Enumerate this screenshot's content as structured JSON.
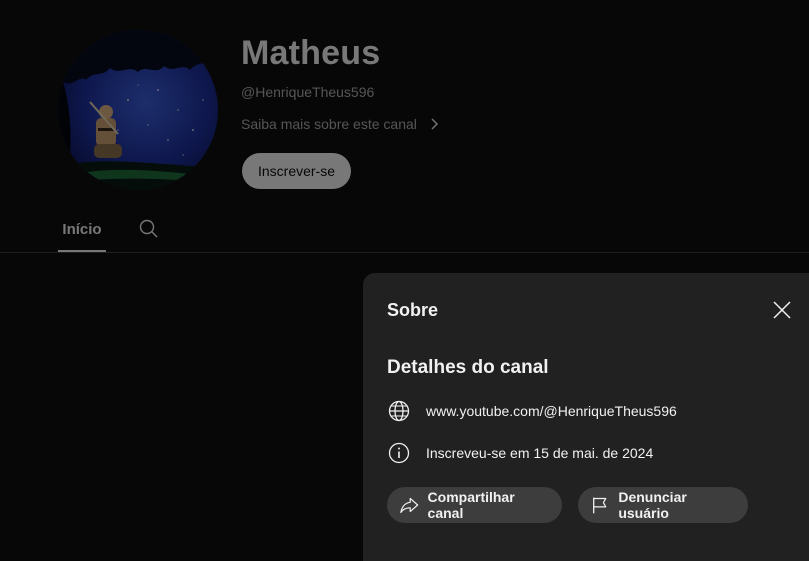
{
  "channel": {
    "name": "Matheus",
    "handle": "@HenriqueTheus596",
    "about_link": "Saiba mais sobre este canal",
    "subscribe_label": "Inscrever-se"
  },
  "tabs": {
    "home_label": "Início"
  },
  "about_panel": {
    "title": "Sobre",
    "section_title": "Detalhes do canal",
    "url": "www.youtube.com/@HenriqueTheus596",
    "joined": "Inscreveu-se em 15 de mai. de 2024",
    "share_label": "Compartilhar canal",
    "report_label": "Denunciar usuário"
  },
  "icons": {
    "about_chevron": "chevron-right-icon",
    "search": "search-icon",
    "close": "close-icon",
    "globe": "globe-icon",
    "info": "info-icon",
    "share": "share-icon",
    "flag": "flag-icon"
  },
  "colors": {
    "background": "#0f0f0f",
    "panel": "#212121",
    "pill": "#3d3d3d",
    "text_primary": "#f1f1f1",
    "text_secondary": "#aaaaaa"
  }
}
